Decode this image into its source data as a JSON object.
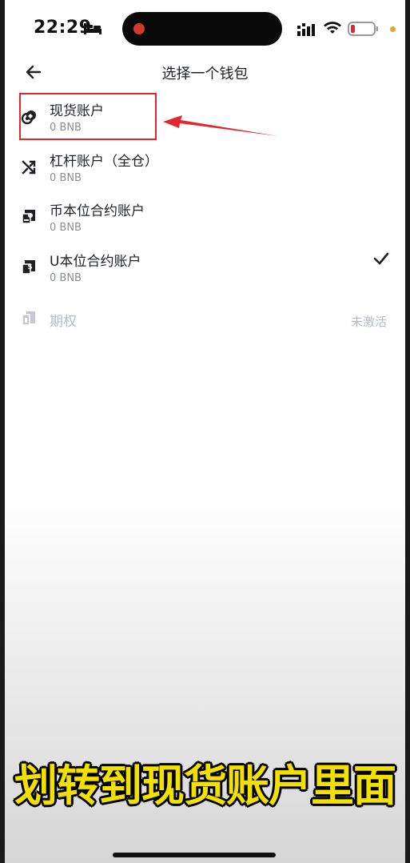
{
  "status_bar": {
    "time": "22:29",
    "icons": [
      "bed-icon",
      "signal-icon",
      "wifi-icon",
      "battery-icon"
    ]
  },
  "header": {
    "back_icon": "arrow-left-icon",
    "title": "选择一个钱包"
  },
  "wallets": [
    {
      "name": "现货账户",
      "balance": "0 BNB",
      "icon": "spot-wallet-icon",
      "selected": false,
      "enabled": true
    },
    {
      "name": "杠杆账户（全仓）",
      "balance": "0 BNB",
      "icon": "margin-icon",
      "selected": false,
      "enabled": true
    },
    {
      "name": "币本位合约账户",
      "balance": "0 BNB",
      "icon": "coin-futures-icon",
      "selected": false,
      "enabled": true
    },
    {
      "name": "U本位合约账户",
      "balance": "0 BNB",
      "icon": "usd-futures-icon",
      "selected": true,
      "enabled": true
    },
    {
      "name": "期权",
      "status": "未激活",
      "icon": "options-icon",
      "selected": false,
      "enabled": false
    }
  ],
  "caption": "划转到现货账户里面",
  "colors": {
    "annotation_red": "#e3262b",
    "caption_yellow": "#f2e000",
    "text_primary": "#1e2026",
    "text_secondary": "#8a8d93",
    "text_disabled": "#b7bcc3"
  }
}
